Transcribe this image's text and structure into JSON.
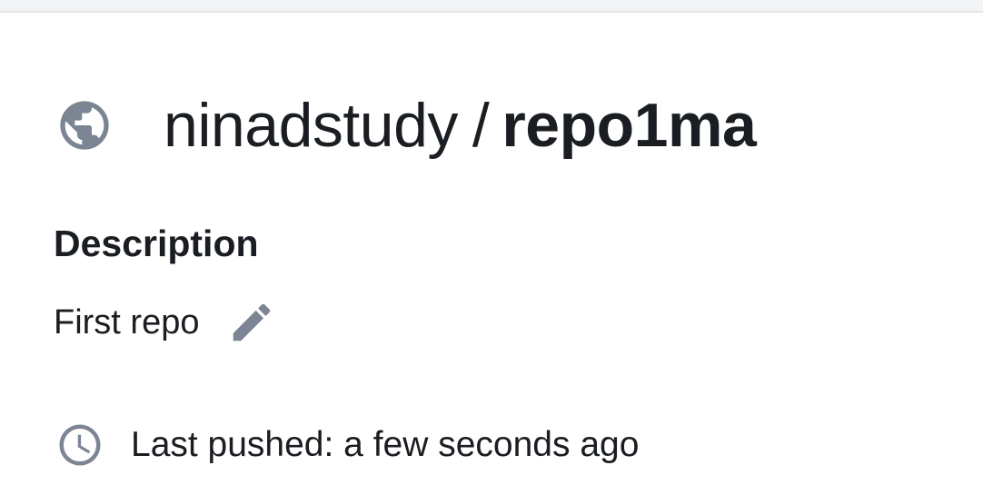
{
  "repository": {
    "namespace": "ninadstudy",
    "separator": "/",
    "name": "repo1ma",
    "visibility_icon": "globe-icon"
  },
  "description": {
    "heading": "Description",
    "text": "First repo",
    "edit_icon": "pencil-icon"
  },
  "last_pushed": {
    "icon": "clock-icon",
    "text": "Last pushed: a few seconds ago"
  },
  "colors": {
    "icon_gray": "#7c8594",
    "text": "#1a1d21",
    "divider": "#e3e5e9"
  }
}
